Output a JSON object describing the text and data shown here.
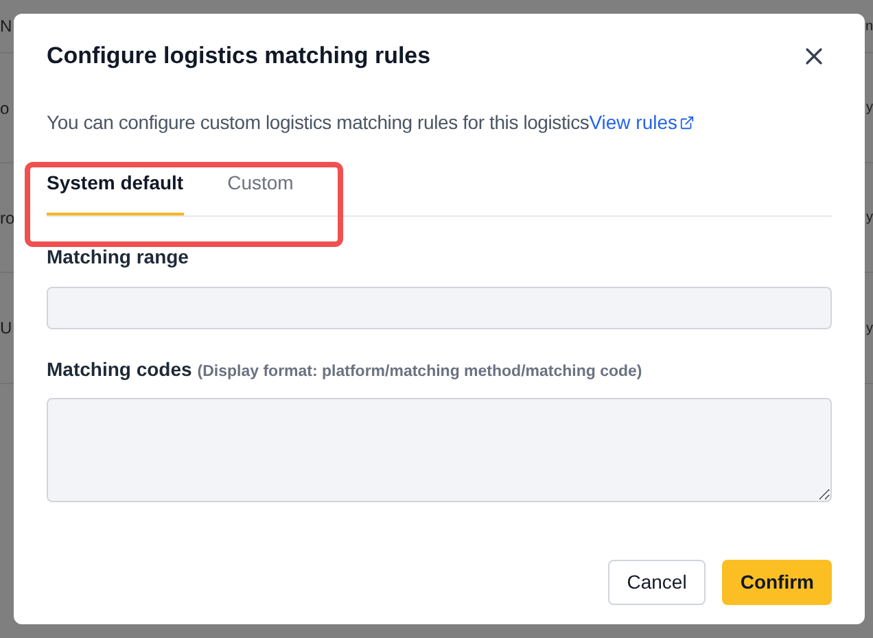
{
  "background_table": {
    "left_column": [
      "N",
      "o",
      "ro",
      "U"
    ],
    "right_column": [
      "n",
      "y",
      "y",
      "y"
    ]
  },
  "dialog": {
    "title": "Configure logistics matching rules",
    "description": "You can configure custom logistics matching rules for this logistics",
    "link": "View rules",
    "tabs": [
      {
        "label": "System default",
        "selected": true
      },
      {
        "label": "Custom",
        "selected": false
      }
    ],
    "fields": [
      {
        "kind": "input",
        "label": "Matching range"
      },
      {
        "kind": "textarea",
        "label": "Matching codes",
        "hint": "(Display format: platform/matching method/matching code)"
      }
    ],
    "buttons": [
      {
        "label": "Cancel",
        "kind": "secondary"
      },
      {
        "label": "Confirm",
        "kind": "primary"
      }
    ]
  }
}
